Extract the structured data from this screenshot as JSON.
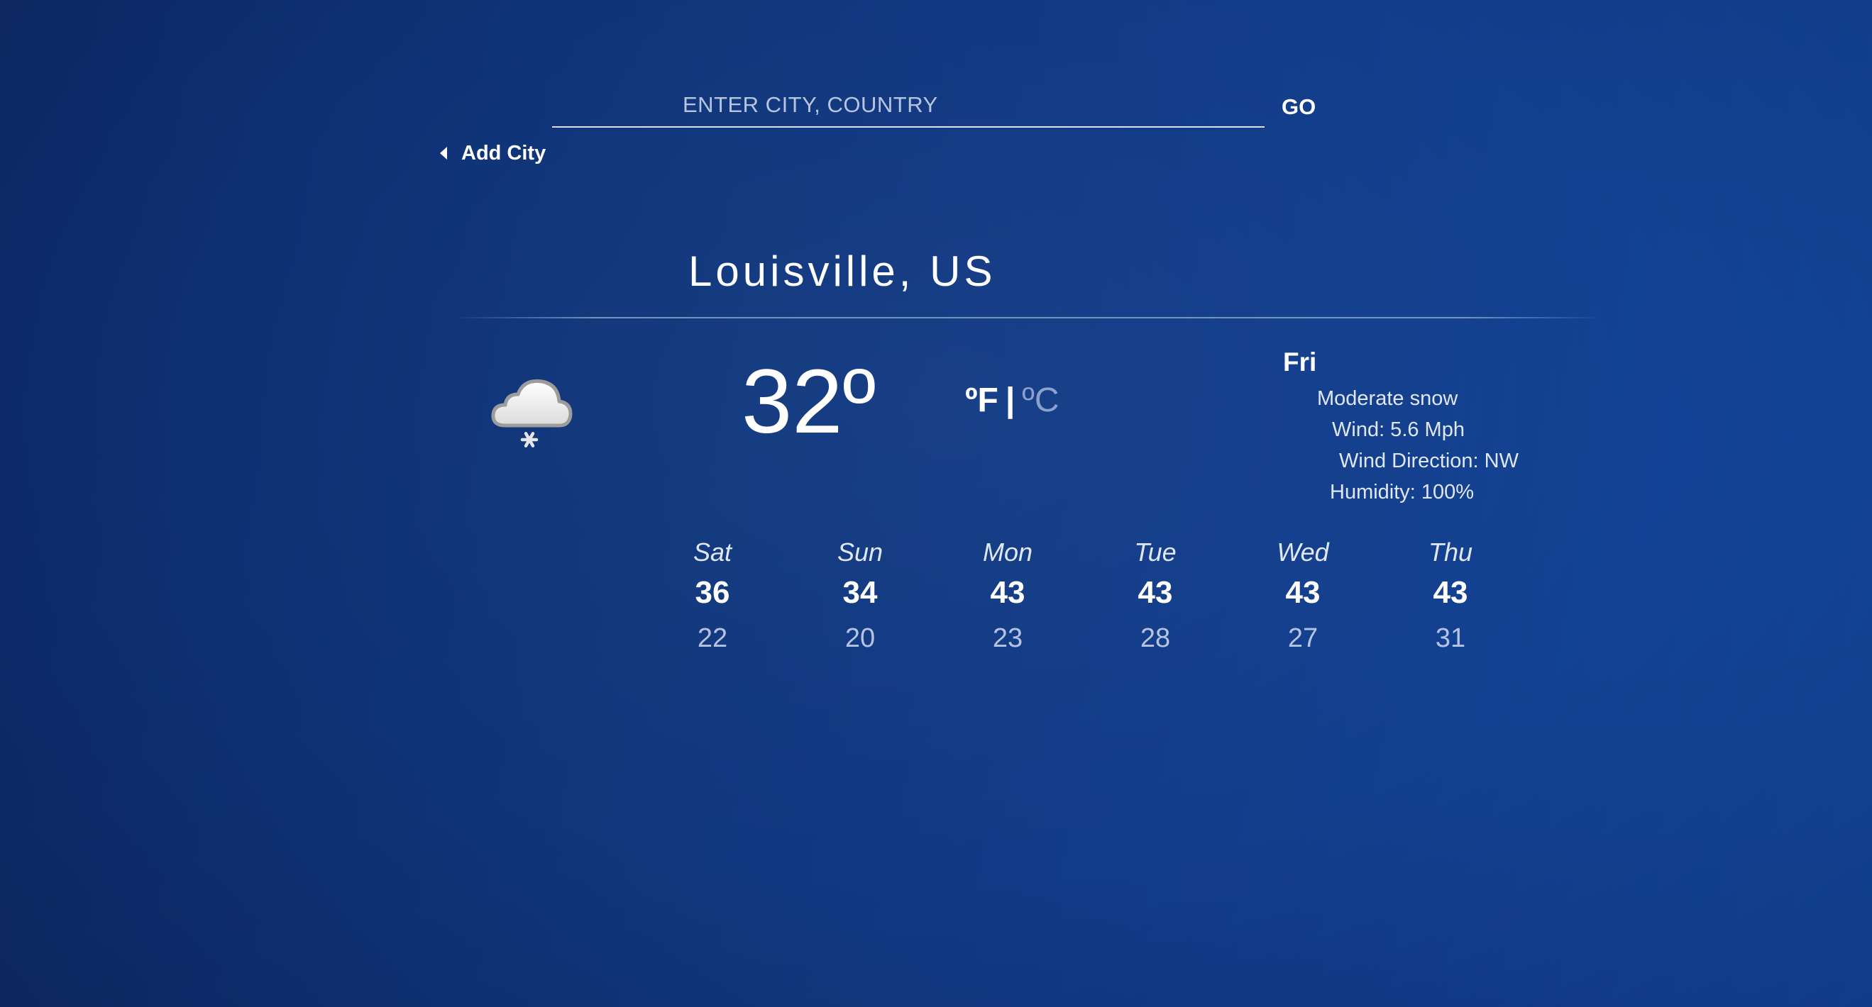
{
  "search": {
    "placeholder": "ENTER CITY, COUNTRY",
    "value": "",
    "go_label": "GO"
  },
  "add_city": {
    "label": "Add City",
    "icon": "caret-left-icon"
  },
  "location": {
    "title": "Louisville, US"
  },
  "current": {
    "icon": "snow-cloud-icon",
    "temperature": "32º",
    "unit_f": "ºF",
    "unit_separator": "|",
    "unit_c": "ºC",
    "day": "Fri",
    "description": "Moderate snow",
    "wind": "Wind: 5.6 Mph",
    "wind_direction": "Wind Direction: NW",
    "humidity": "Humidity: 100%"
  },
  "forecast": [
    {
      "day": "Sat",
      "high": "36",
      "low": "22"
    },
    {
      "day": "Sun",
      "high": "34",
      "low": "20"
    },
    {
      "day": "Mon",
      "high": "43",
      "low": "23"
    },
    {
      "day": "Tue",
      "high": "43",
      "low": "28"
    },
    {
      "day": "Wed",
      "high": "43",
      "low": "27"
    },
    {
      "day": "Thu",
      "high": "43",
      "low": "31"
    }
  ],
  "colors": {
    "background_start": "#0d2c6c",
    "background_end": "#1448a0",
    "text": "#ffffff",
    "inactive_unit": "#8ea3cf"
  }
}
